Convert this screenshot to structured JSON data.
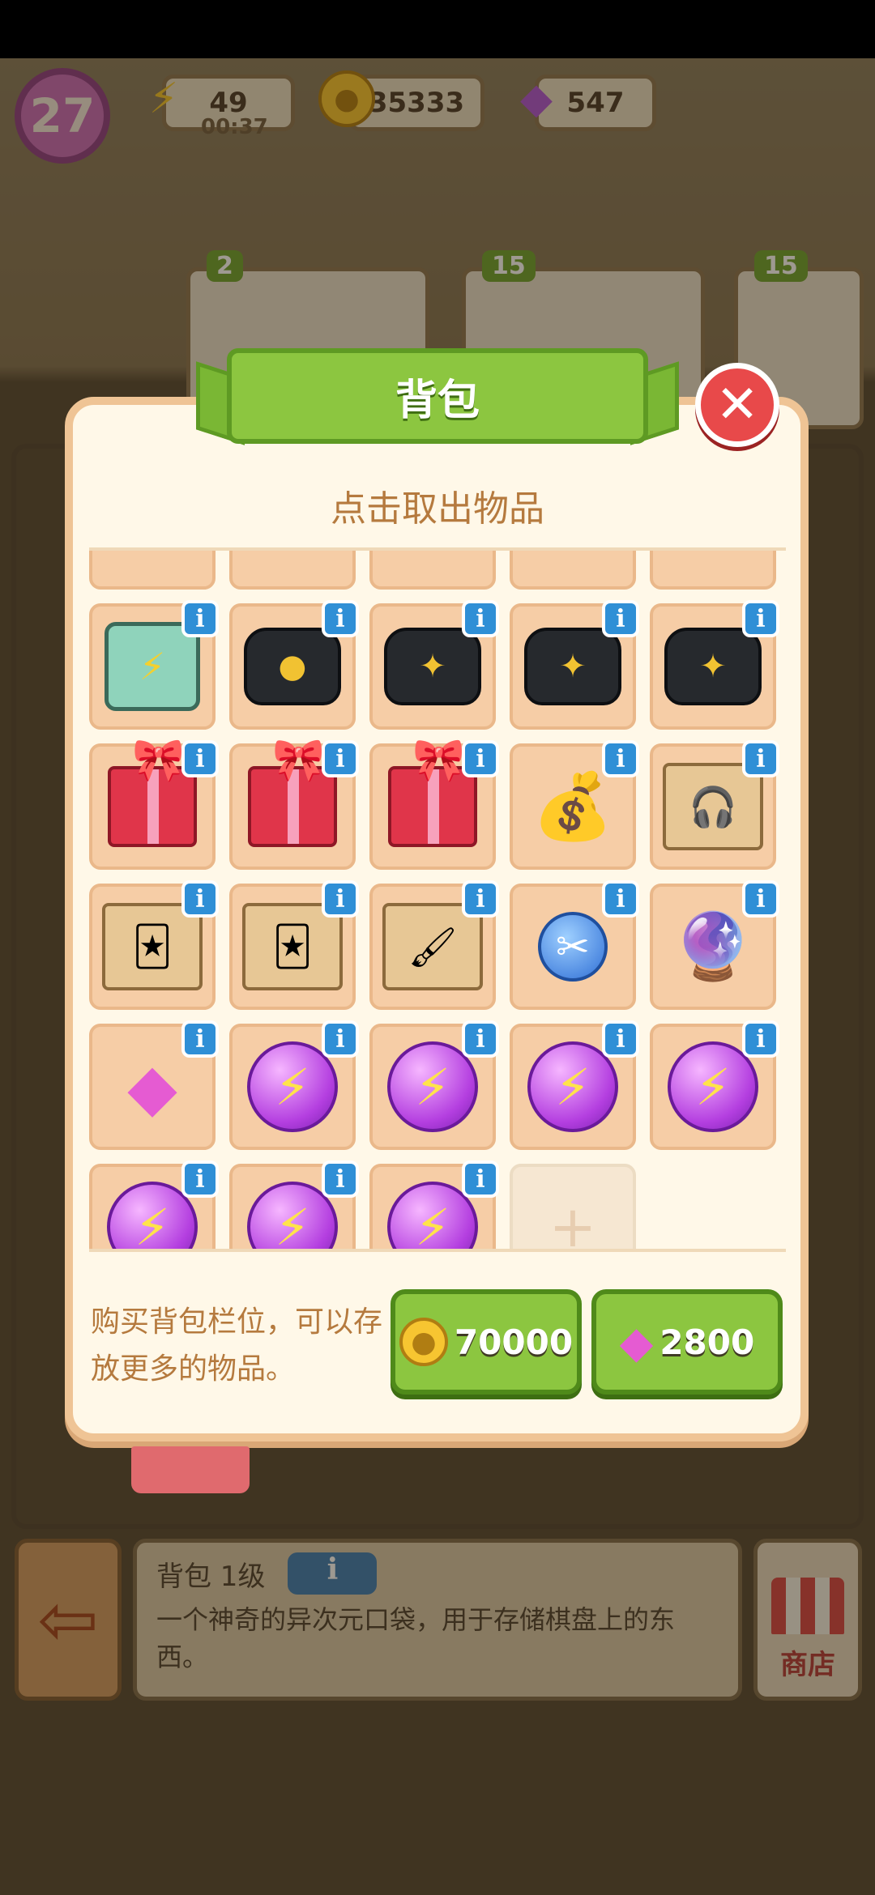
{
  "hud": {
    "level": "27",
    "energy": "49",
    "energy_timer": "00:37",
    "coins": "35333",
    "gems": "547"
  },
  "background_orders": [
    {
      "stars": "2"
    },
    {
      "stars": "15"
    },
    {
      "stars": "15"
    }
  ],
  "modal": {
    "title": "背包",
    "hint": "点击取出物品",
    "close_icon": "close-icon",
    "slots": [
      {
        "icon": "partial-item",
        "info": false
      },
      {
        "icon": "partial-item",
        "info": false
      },
      {
        "icon": "partial-item",
        "info": false
      },
      {
        "icon": "partial-item",
        "info": false
      },
      {
        "icon": "partial-item",
        "info": false
      },
      {
        "icon": "energy-case-icon",
        "glyph": "⚡",
        "info": true
      },
      {
        "icon": "black-bag-icon",
        "glyph": "●",
        "info": true
      },
      {
        "icon": "black-bag-icon",
        "glyph": "✦",
        "info": true
      },
      {
        "icon": "black-bag-icon",
        "glyph": "✦",
        "info": true
      },
      {
        "icon": "black-bag-icon",
        "glyph": "✦",
        "info": true
      },
      {
        "icon": "gift-box-icon",
        "glyph": "",
        "info": true
      },
      {
        "icon": "gift-box-icon",
        "glyph": "",
        "info": true
      },
      {
        "icon": "gift-box-icon",
        "glyph": "",
        "info": true
      },
      {
        "icon": "coin-bag-icon",
        "glyph": "💰",
        "info": true
      },
      {
        "icon": "headphones-box-icon",
        "glyph": "🎧",
        "info": true
      },
      {
        "icon": "card-box-icon",
        "glyph": "🃏",
        "info": true
      },
      {
        "icon": "card-box-icon",
        "glyph": "🃏",
        "info": true
      },
      {
        "icon": "paint-box-icon",
        "glyph": "🖌",
        "info": true
      },
      {
        "icon": "scissors-token-icon",
        "glyph": "✂",
        "info": true
      },
      {
        "icon": "plasma-ball-icon",
        "glyph": "🔮",
        "info": true
      },
      {
        "icon": "gem-pile-icon",
        "glyph": "◆",
        "info": true
      },
      {
        "icon": "energy-orb-icon",
        "glyph": "⚡",
        "info": true
      },
      {
        "icon": "energy-orb-icon",
        "glyph": "⚡",
        "info": true
      },
      {
        "icon": "energy-orb-icon",
        "glyph": "⚡",
        "info": true
      },
      {
        "icon": "energy-orb-icon",
        "glyph": "⚡",
        "info": true
      },
      {
        "icon": "energy-orb-icon",
        "glyph": "⚡",
        "info": true
      },
      {
        "icon": "energy-orb-icon",
        "glyph": "⚡",
        "info": true
      },
      {
        "icon": "energy-orb-icon",
        "glyph": "⚡",
        "info": true
      },
      {
        "icon": "empty-slot-plus-icon",
        "glyph": "+",
        "info": false
      }
    ],
    "buy_text": "购买背包栏位，可以存放更多的物品。",
    "buy_coins_price": "70000",
    "buy_gems_price": "2800"
  },
  "bottom_info": {
    "title": "背包 1级",
    "info_glyph": "i",
    "description": "一个神奇的异次元口袋，用于存储棋盘上的东西。"
  },
  "shop_label": "商店",
  "colors": {
    "accent_green": "#8cc640",
    "info_blue": "#2f8fd6",
    "close_red": "#e8494a",
    "hint_text": "#b57a3e"
  }
}
